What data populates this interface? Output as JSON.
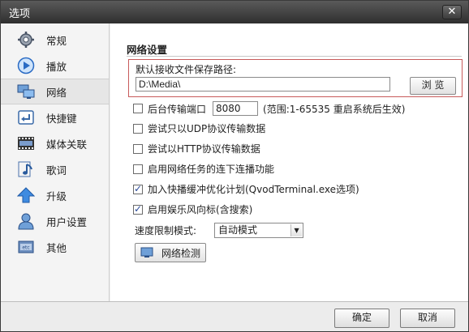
{
  "window": {
    "title": "选项",
    "close_glyph": "✕"
  },
  "sidebar": {
    "items": [
      {
        "label": "常规",
        "icon": "gear-icon"
      },
      {
        "label": "播放",
        "icon": "play-icon"
      },
      {
        "label": "网络",
        "icon": "network-icon",
        "active": true
      },
      {
        "label": "快捷键",
        "icon": "shortcut-key-icon"
      },
      {
        "label": "媒体关联",
        "icon": "media-film-icon"
      },
      {
        "label": "歌词",
        "icon": "lyrics-note-icon"
      },
      {
        "label": "升级",
        "icon": "upgrade-arrow-icon"
      },
      {
        "label": "用户设置",
        "icon": "user-icon"
      },
      {
        "label": "其他",
        "icon": "other-icon"
      }
    ]
  },
  "network": {
    "section_title": "网络设置",
    "save_path_label": "默认接收文件保存路径:",
    "save_path_value": "D:\\Media\\",
    "browse_label": "浏 览",
    "port_label": "后台传输端口",
    "port_value": "8080",
    "port_hint": "(范围:1-65535 重启系统后生效)",
    "options": [
      {
        "label": "尝试只以UDP协议传输数据",
        "checked": false
      },
      {
        "label": "尝试以HTTP协议传输数据",
        "checked": false
      },
      {
        "label": "启用网络任务的连下连播功能",
        "checked": false
      },
      {
        "label": "加入快播缓冲优化计划(QvodTerminal.exe选项)",
        "checked": true
      },
      {
        "label": "启用娱乐风向标(含搜索)",
        "checked": true
      }
    ],
    "speed_label": "速度限制模式:",
    "speed_value": "自动模式",
    "net_check_label": "网络检测"
  },
  "footer": {
    "ok_label": "确定",
    "cancel_label": "取消"
  }
}
